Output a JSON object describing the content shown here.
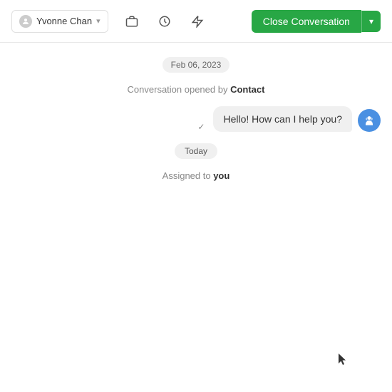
{
  "header": {
    "assignee": "Yvonne Chan",
    "close_btn_label": "Close Conversation",
    "dropdown_arrow": "▾"
  },
  "icons": {
    "suitcase": "💼",
    "clock": "⏱",
    "lightning": "⚡",
    "user": "👤"
  },
  "chat": {
    "date_label": "Feb 06, 2023",
    "system_open": "Conversation opened by ",
    "system_contact": "Contact",
    "message_text": "Hello! How can I help you?",
    "today_label": "Today",
    "assigned_text": "Assigned to ",
    "assigned_you": "you"
  }
}
